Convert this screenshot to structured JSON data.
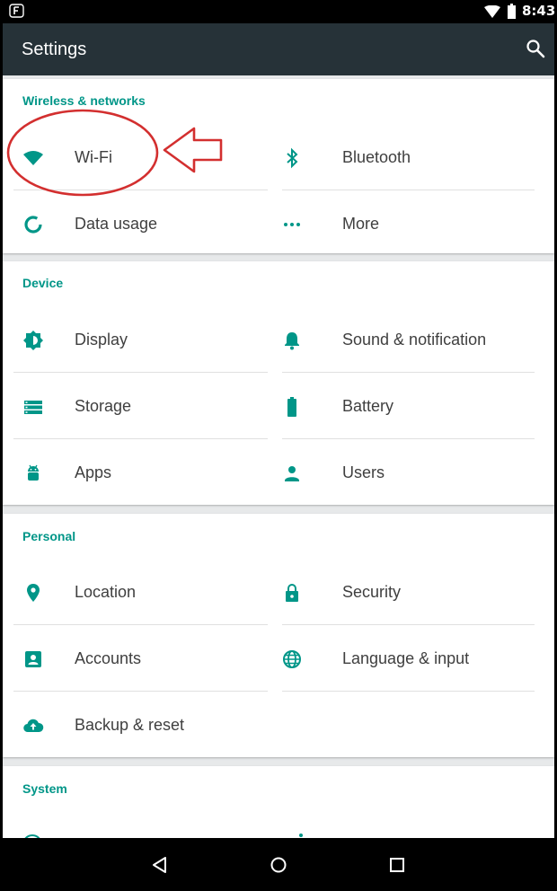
{
  "status_bar": {
    "time": "8:43",
    "notification_icon": "f-notification-icon",
    "wifi_icon": "wifi-icon",
    "battery_icon": "battery-icon"
  },
  "app_bar": {
    "title": "Settings",
    "search_icon": "search-icon"
  },
  "sections": [
    {
      "title": "Wireless & networks",
      "items": [
        {
          "label": "Wi-Fi",
          "icon": "wifi-icon"
        },
        {
          "label": "Bluetooth",
          "icon": "bluetooth-icon"
        },
        {
          "label": "Data usage",
          "icon": "data-usage-icon"
        },
        {
          "label": "More",
          "icon": "more-icon"
        }
      ]
    },
    {
      "title": "Device",
      "items": [
        {
          "label": "Display",
          "icon": "display-icon"
        },
        {
          "label": "Sound & notification",
          "icon": "bell-icon"
        },
        {
          "label": "Storage",
          "icon": "storage-icon"
        },
        {
          "label": "Battery",
          "icon": "battery-icon"
        },
        {
          "label": "Apps",
          "icon": "android-icon"
        },
        {
          "label": "Users",
          "icon": "user-icon"
        }
      ]
    },
    {
      "title": "Personal",
      "items": [
        {
          "label": "Location",
          "icon": "location-icon"
        },
        {
          "label": "Security",
          "icon": "lock-icon"
        },
        {
          "label": "Accounts",
          "icon": "account-icon"
        },
        {
          "label": "Language & input",
          "icon": "globe-icon"
        },
        {
          "label": "Backup & reset",
          "icon": "cloud-upload-icon"
        }
      ]
    },
    {
      "title": "System",
      "items": []
    }
  ],
  "nav_bar": {
    "back_icon": "back-icon",
    "home_icon": "home-icon",
    "recents_icon": "recents-icon"
  },
  "colors": {
    "accent": "#009688",
    "app_bar": "#263238",
    "background": "#e7e9ea",
    "annotation": "#d32f2f"
  }
}
